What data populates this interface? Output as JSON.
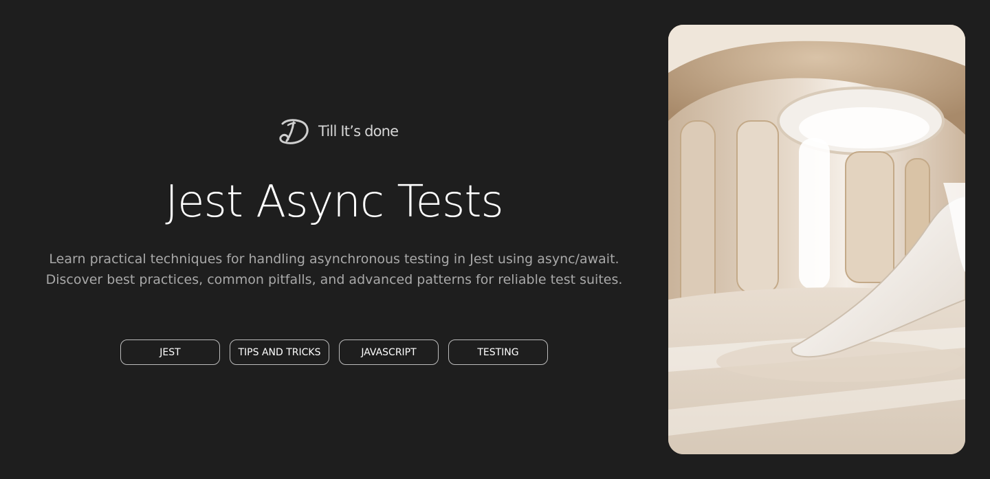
{
  "brand": {
    "logo_icon": "cursive-d-logo-icon",
    "name": "Till It’s done"
  },
  "hero": {
    "title": "Jest Async Tests",
    "description_lines": [
      "Learn practical techniques for handling asynchronous testing in Jest using async/await.",
      "Discover best practices, common pitfalls, and advanced patterns for reliable test suites."
    ]
  },
  "tags": [
    {
      "label": "JEST"
    },
    {
      "label": "TIPS AND TRICKS"
    },
    {
      "label": "JAVASCRIPT"
    },
    {
      "label": "TESTING"
    }
  ],
  "colors": {
    "background": "#1e1e1e",
    "title": "#ffffff",
    "description": "#a9a9a9",
    "tag_border": "#bdbdbd"
  }
}
